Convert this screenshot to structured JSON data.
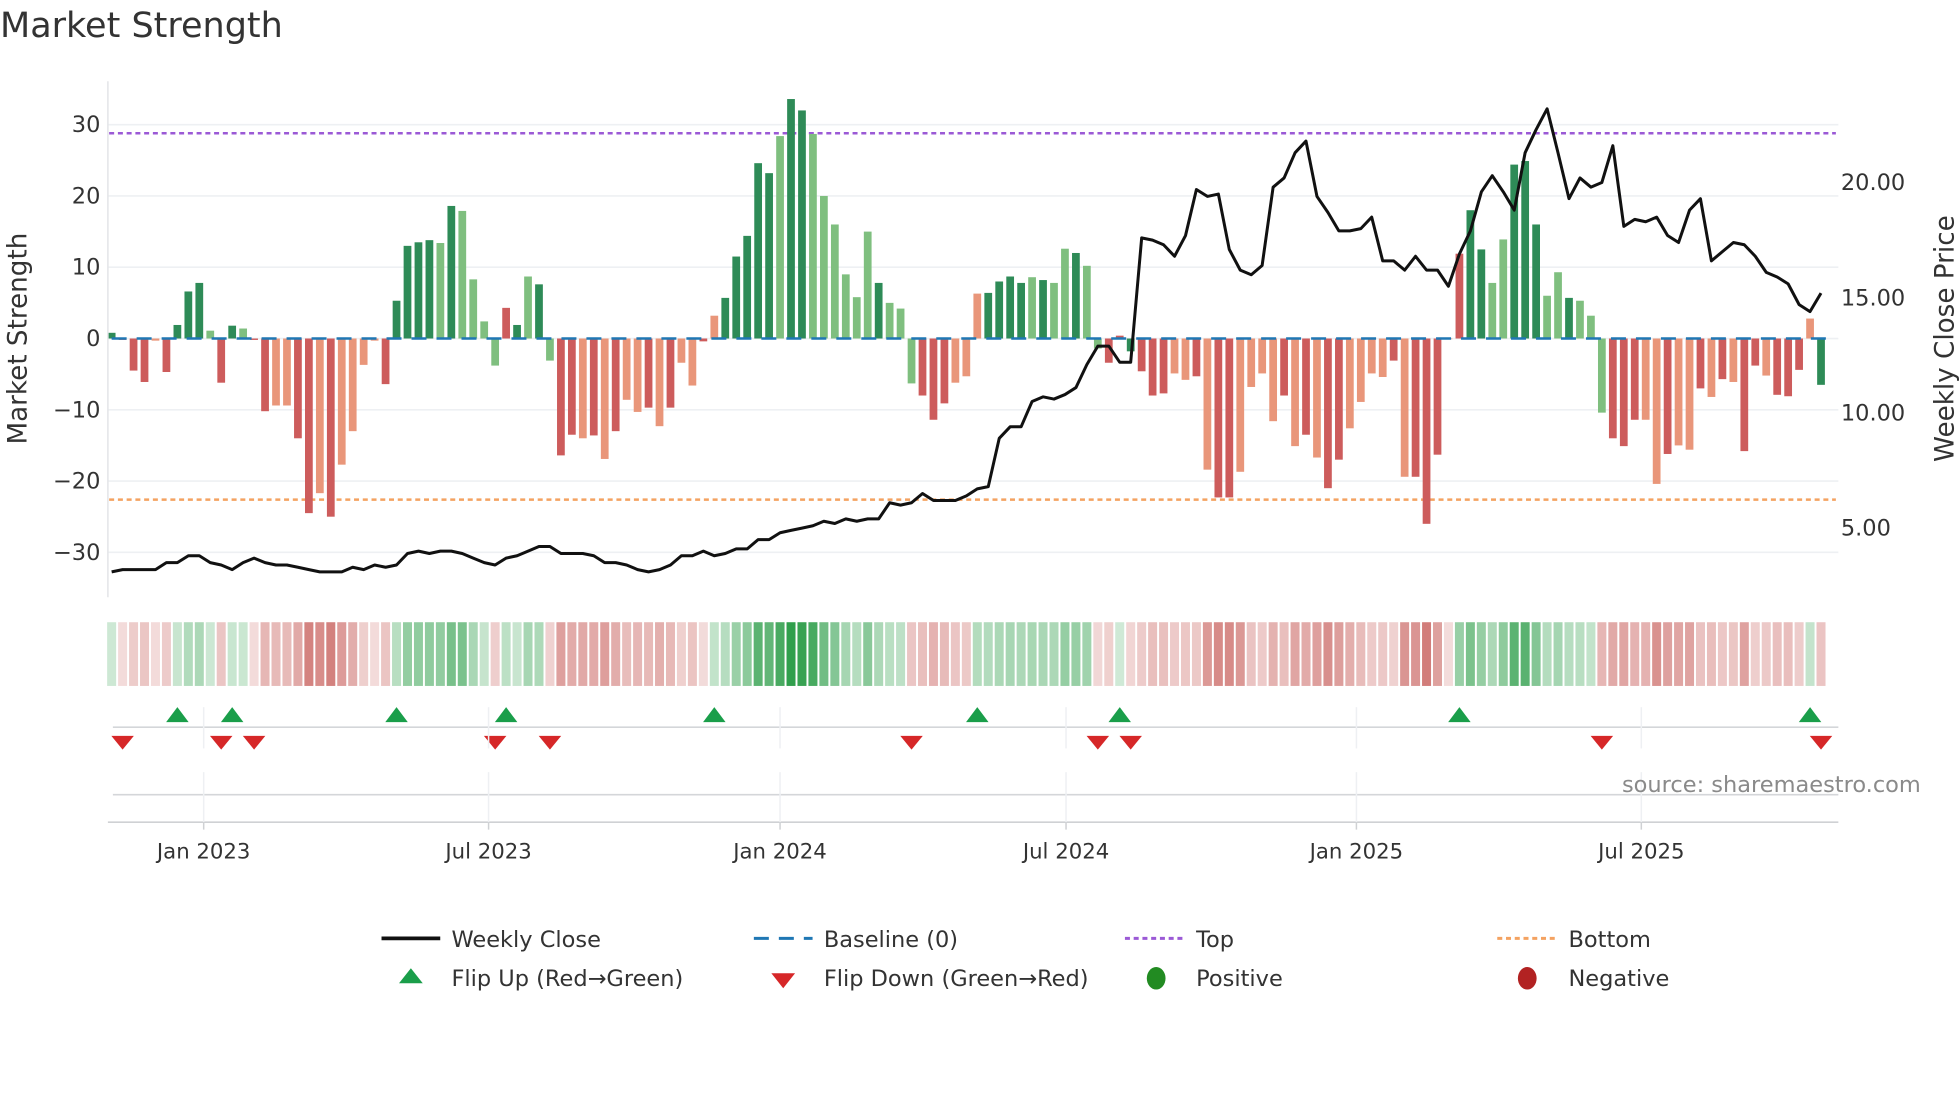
{
  "title": "Market Strength",
  "source": "source: sharemaestro.com",
  "legend": {
    "weekly_close": "Weekly Close",
    "baseline": "Baseline (0)",
    "top": "Top",
    "bottom": "Bottom",
    "flip_up": "Flip Up (Red→Green)",
    "flip_down": "Flip Down (Green→Red)",
    "positive": "Positive",
    "negative": "Negative"
  },
  "colors": {
    "green_dark": "#2e8b57",
    "green_light": "#7fbf7f",
    "red_dark": "#cd5c5c",
    "red_light": "#e9967a",
    "baseline": "#1f77b4",
    "top": "#9b59d6",
    "bottom": "#f4a261",
    "line": "#111111",
    "flip_up": "#1a9e4a",
    "flip_down": "#d62728",
    "positive": "#228b22",
    "negative": "#b22222",
    "strip_green": "#2e9e4a",
    "strip_red": "#c8605c"
  },
  "chart_data": {
    "type": "bar",
    "title": "Market Strength",
    "ylabel": "Market Strength",
    "y2label": "Weekly Close Price",
    "ylim": [
      -36.3,
      36.1
    ],
    "y2lim": [
      2.0,
      24.4
    ],
    "yticks": [
      "30",
      "20",
      "10",
      "0",
      "−10",
      "−20",
      "−30"
    ],
    "ytick_values": [
      30,
      20,
      10,
      0,
      -10,
      -20,
      -30
    ],
    "y2ticks": [
      "20.00",
      "15.00",
      "10.00",
      "5.00"
    ],
    "y2tick_values": [
      20,
      15,
      10,
      5
    ],
    "xticks": [
      {
        "label": "Jan 2023",
        "week": 8.4
      },
      {
        "label": "Jul 2023",
        "week": 34.4
      },
      {
        "label": "Jan 2024",
        "week": 61.0
      },
      {
        "label": "Jul 2024",
        "week": 87.1
      },
      {
        "label": "Jan 2025",
        "week": 113.6
      },
      {
        "label": "Jul 2025",
        "week": 139.6
      }
    ],
    "top_level": 28.8,
    "bottom_level": -22.6,
    "grid": true,
    "legend_position": "bottom",
    "strength": [
      0.8,
      -0.2,
      -4.5,
      -6.1,
      -0.3,
      -4.7,
      1.9,
      6.6,
      7.8,
      1.1,
      -6.2,
      1.8,
      1.4,
      -0.2,
      -10.2,
      -9.4,
      -9.4,
      -14,
      -24.5,
      -21.7,
      -25,
      -17.7,
      -13,
      -3.7,
      -0.3,
      -6.4,
      5.3,
      13,
      13.5,
      13.8,
      13.4,
      18.6,
      17.9,
      8.3,
      2.4,
      -3.8,
      4.3,
      1.9,
      8.7,
      7.6,
      -3.1,
      -16.4,
      -13.5,
      -14,
      -13.6,
      -16.9,
      -13,
      -8.6,
      -10.3,
      -9.7,
      -12.3,
      -9.7,
      -3.4,
      -6.6,
      -0.4,
      3.2,
      5.7,
      11.5,
      14.4,
      24.6,
      23.2,
      28.4,
      33.6,
      32.0,
      28.7,
      20,
      16,
      9,
      5.8,
      15,
      7.8,
      5,
      4.2,
      -6.3,
      -8,
      -11.4,
      -9.1,
      -6.2,
      -5.3,
      6.3,
      6.4,
      8,
      8.7,
      7.8,
      8.6,
      8.2,
      7.8,
      12.6,
      12,
      10.2,
      -1.4,
      -3.4,
      0.4,
      -1.8,
      -4.6,
      -8.0,
      -7.7,
      -4.9,
      -5.8,
      -5.3,
      -18.4,
      -22.3,
      -22.3,
      -18.7,
      -6.8,
      -4.9,
      -11.6,
      -8,
      -15.1,
      -13.5,
      -16.7,
      -21,
      -17,
      -12.6,
      -8.9,
      -4.9,
      -5.4,
      -3.1,
      -19.4,
      -19.4,
      -26,
      -16.3,
      -0.1,
      11.9,
      18,
      12.5,
      7.8,
      13.9,
      24.4,
      24.9,
      16,
      6,
      9.3,
      5.7,
      5.3,
      3.2,
      -10.4,
      -14,
      -15.1,
      -11.4,
      -11.4,
      -20.4,
      -16.2,
      -15,
      -15.6,
      -7,
      -8.2,
      -5.7,
      -6.1,
      -15.8,
      -3.8,
      -5.2,
      -7.9,
      -8.1,
      -4.4,
      2.8,
      -6.5
    ],
    "shade": "GRRRrRGGGgRGgRRrrRRrRrrrrRGGGGgGggggRGgGgRRrRrRrrRrRrrRrGGGGGgGGggggggGgggRRRrrrGGGGgGggGggRRGRRRrrRrRRrrrrRrRrRRrrrrRrRRRrRGGggGGGggGgggRRRrrRrrRrRrRRrRRRrGR",
    "weekly_close": [
      3.1,
      3.2,
      3.2,
      3.2,
      3.2,
      3.5,
      3.5,
      3.8,
      3.8,
      3.5,
      3.4,
      3.2,
      3.5,
      3.7,
      3.5,
      3.4,
      3.4,
      3.3,
      3.2,
      3.1,
      3.1,
      3.1,
      3.3,
      3.2,
      3.4,
      3.3,
      3.4,
      3.9,
      4.0,
      3.9,
      4.0,
      4.0,
      3.9,
      3.7,
      3.5,
      3.4,
      3.7,
      3.8,
      4.0,
      4.2,
      4.2,
      3.9,
      3.9,
      3.9,
      3.8,
      3.5,
      3.5,
      3.4,
      3.2,
      3.1,
      3.2,
      3.4,
      3.8,
      3.8,
      4.0,
      3.8,
      3.9,
      4.1,
      4.1,
      4.5,
      4.5,
      4.8,
      4.9,
      5.0,
      5.1,
      5.3,
      5.2,
      5.4,
      5.3,
      5.4,
      5.4,
      6.1,
      6.0,
      6.1,
      6.5,
      6.2,
      6.2,
      6.2,
      6.4,
      6.7,
      6.8,
      8.9,
      9.4,
      9.4,
      10.5,
      10.7,
      10.6,
      10.8,
      11.1,
      12.1,
      12.9,
      12.9,
      12.2,
      12.2,
      17.6,
      17.5,
      17.3,
      16.8,
      17.7,
      19.7,
      19.4,
      19.5,
      17.1,
      16.2,
      16.0,
      16.4,
      19.8,
      20.2,
      21.3,
      21.8,
      19.4,
      18.7,
      17.9,
      17.9,
      18.0,
      18.5,
      16.6,
      16.6,
      16.2,
      16.8,
      16.2,
      16.2,
      15.5,
      16.9,
      17.9,
      19.6,
      20.3,
      19.6,
      18.8,
      21.3,
      22.3,
      23.2,
      21.3,
      19.3,
      20.2,
      19.8,
      20.0,
      21.6,
      18.1,
      18.4,
      18.3,
      18.5,
      17.7,
      17.4,
      18.8,
      19.3,
      16.6,
      17.0,
      17.4,
      17.3,
      16.8,
      16.1,
      15.9,
      15.6,
      14.7,
      14.4,
      15.2
    ],
    "flip_up_weeks": [
      6,
      11,
      26,
      36,
      55,
      79,
      92,
      123,
      155
    ],
    "flip_down_weeks": [
      1,
      10,
      13,
      35,
      40,
      73,
      90,
      93,
      136,
      156
    ]
  }
}
